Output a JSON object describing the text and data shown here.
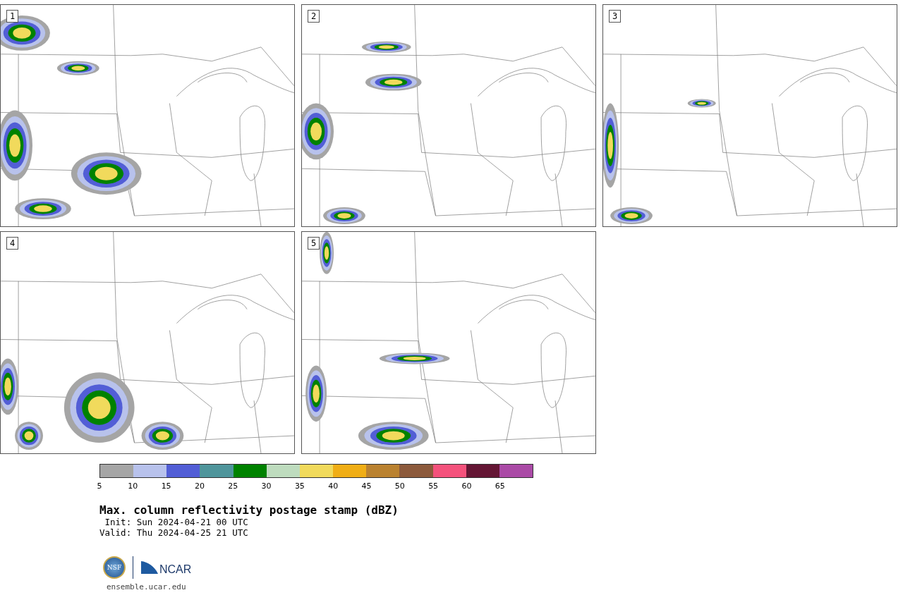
{
  "panels": [
    {
      "label": "1"
    },
    {
      "label": "2"
    },
    {
      "label": "3"
    },
    {
      "label": "4"
    },
    {
      "label": "5"
    }
  ],
  "colorbar": {
    "bins": [
      {
        "label": "5",
        "color": "#a5a5a5"
      },
      {
        "label": "10",
        "color": "#b8c2ec"
      },
      {
        "label": "15",
        "color": "#525ed6"
      },
      {
        "label": "20",
        "color": "#4f959b"
      },
      {
        "label": "25",
        "color": "#008200"
      },
      {
        "label": "30",
        "color": "#bedcbe"
      },
      {
        "label": "35",
        "color": "#f1da5c"
      },
      {
        "label": "40",
        "color": "#f0ae16"
      },
      {
        "label": "45",
        "color": "#ba8230"
      },
      {
        "label": "50",
        "color": "#8c5a3c"
      },
      {
        "label": "55",
        "color": "#f4527c"
      },
      {
        "label": "60",
        "color": "#641634"
      },
      {
        "label": "65",
        "color": "#aa4aa6"
      }
    ]
  },
  "title": "Max. column reflectivity postage stamp (dBZ)",
  "init": " Init: Sun 2024-04-21 00 UTC",
  "valid": "Valid: Thu 2024-04-25 21 UTC",
  "logo": {
    "text": "NSF",
    "wordmark": "NCAR"
  },
  "url": "ensemble.ucar.edu"
}
